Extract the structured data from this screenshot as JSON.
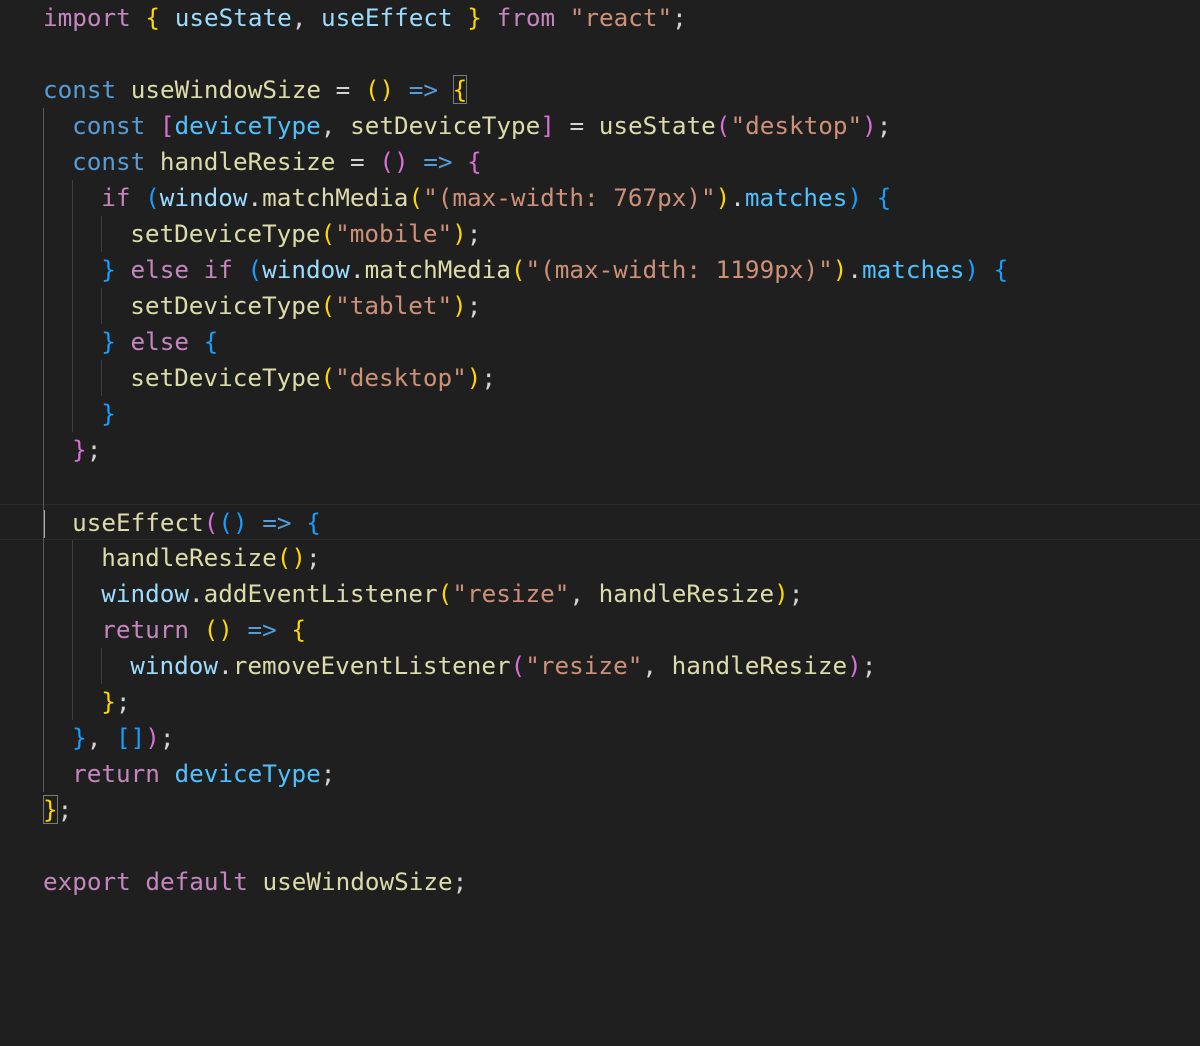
{
  "editor": {
    "language": "javascript",
    "theme": {
      "background": "#1f1f1f",
      "keyword_control": "#c586c0",
      "keyword_storage": "#569cd6",
      "function": "#dcdcaa",
      "variable": "#9cdcfe",
      "string": "#ce9178",
      "number": "#b5cea8",
      "punctuation": "#d4d4d4",
      "bracket_gold": "#ffd700",
      "bracket_orchid": "#da70d6",
      "bracket_blue": "#179fff"
    },
    "cursor_line": 14,
    "lines": [
      {
        "indent": 0,
        "tokens": [
          {
            "t": "import",
            "c": "#c586c0"
          },
          {
            "t": " "
          },
          {
            "t": "{",
            "c": "#ffd700"
          },
          {
            "t": " "
          },
          {
            "t": "useState",
            "c": "#9cdcfe"
          },
          {
            "t": ", "
          },
          {
            "t": "useEffect",
            "c": "#9cdcfe"
          },
          {
            "t": " "
          },
          {
            "t": "}",
            "c": "#ffd700"
          },
          {
            "t": " "
          },
          {
            "t": "from",
            "c": "#c586c0"
          },
          {
            "t": " "
          },
          {
            "t": "\"react\"",
            "c": "#ce9178"
          },
          {
            "t": ";"
          }
        ]
      },
      {
        "indent": 0,
        "tokens": []
      },
      {
        "indent": 0,
        "tokens": [
          {
            "t": "const",
            "c": "#569cd6"
          },
          {
            "t": " "
          },
          {
            "t": "useWindowSize",
            "c": "#dcdcaa"
          },
          {
            "t": " = "
          },
          {
            "t": "()",
            "c": "#ffd700"
          },
          {
            "t": " "
          },
          {
            "t": "=>",
            "c": "#569cd6"
          },
          {
            "t": " "
          },
          {
            "t": "{",
            "c": "#ffd700",
            "box": true
          }
        ]
      },
      {
        "indent": 1,
        "tokens": [
          {
            "t": "const",
            "c": "#569cd6"
          },
          {
            "t": " "
          },
          {
            "t": "[",
            "c": "#da70d6"
          },
          {
            "t": "deviceType",
            "c": "#4fc1ff"
          },
          {
            "t": ", "
          },
          {
            "t": "setDeviceType",
            "c": "#dcdcaa"
          },
          {
            "t": "]",
            "c": "#da70d6"
          },
          {
            "t": " = "
          },
          {
            "t": "useState",
            "c": "#dcdcaa"
          },
          {
            "t": "(",
            "c": "#da70d6"
          },
          {
            "t": "\"desktop\"",
            "c": "#ce9178"
          },
          {
            "t": ")",
            "c": "#da70d6"
          },
          {
            "t": ";"
          }
        ]
      },
      {
        "indent": 1,
        "tokens": [
          {
            "t": "const",
            "c": "#569cd6"
          },
          {
            "t": " "
          },
          {
            "t": "handleResize",
            "c": "#dcdcaa"
          },
          {
            "t": " = "
          },
          {
            "t": "()",
            "c": "#da70d6"
          },
          {
            "t": " "
          },
          {
            "t": "=>",
            "c": "#569cd6"
          },
          {
            "t": " "
          },
          {
            "t": "{",
            "c": "#da70d6"
          }
        ]
      },
      {
        "indent": 2,
        "tokens": [
          {
            "t": "if",
            "c": "#c586c0"
          },
          {
            "t": " "
          },
          {
            "t": "(",
            "c": "#179fff"
          },
          {
            "t": "window",
            "c": "#9cdcfe"
          },
          {
            "t": "."
          },
          {
            "t": "matchMedia",
            "c": "#dcdcaa"
          },
          {
            "t": "(",
            "c": "#ffd700"
          },
          {
            "t": "\"(max-width: 767px)\"",
            "c": "#ce9178"
          },
          {
            "t": ")",
            "c": "#ffd700"
          },
          {
            "t": "."
          },
          {
            "t": "matches",
            "c": "#4fc1ff"
          },
          {
            "t": ")",
            "c": "#179fff"
          },
          {
            "t": " "
          },
          {
            "t": "{",
            "c": "#179fff"
          }
        ]
      },
      {
        "indent": 3,
        "tokens": [
          {
            "t": "setDeviceType",
            "c": "#dcdcaa"
          },
          {
            "t": "(",
            "c": "#ffd700"
          },
          {
            "t": "\"mobile\"",
            "c": "#ce9178"
          },
          {
            "t": ")",
            "c": "#ffd700"
          },
          {
            "t": ";"
          }
        ]
      },
      {
        "indent": 2,
        "tokens": [
          {
            "t": "}",
            "c": "#179fff"
          },
          {
            "t": " "
          },
          {
            "t": "else",
            "c": "#c586c0"
          },
          {
            "t": " "
          },
          {
            "t": "if",
            "c": "#c586c0"
          },
          {
            "t": " "
          },
          {
            "t": "(",
            "c": "#179fff"
          },
          {
            "t": "window",
            "c": "#9cdcfe"
          },
          {
            "t": "."
          },
          {
            "t": "matchMedia",
            "c": "#dcdcaa"
          },
          {
            "t": "(",
            "c": "#ffd700"
          },
          {
            "t": "\"(max-width: 1199px)\"",
            "c": "#ce9178"
          },
          {
            "t": ")",
            "c": "#ffd700"
          },
          {
            "t": "."
          },
          {
            "t": "matches",
            "c": "#4fc1ff"
          },
          {
            "t": ")",
            "c": "#179fff"
          },
          {
            "t": " "
          },
          {
            "t": "{",
            "c": "#179fff"
          }
        ]
      },
      {
        "indent": 3,
        "tokens": [
          {
            "t": "setDeviceType",
            "c": "#dcdcaa"
          },
          {
            "t": "(",
            "c": "#ffd700"
          },
          {
            "t": "\"tablet\"",
            "c": "#ce9178"
          },
          {
            "t": ")",
            "c": "#ffd700"
          },
          {
            "t": ";"
          }
        ]
      },
      {
        "indent": 2,
        "tokens": [
          {
            "t": "}",
            "c": "#179fff"
          },
          {
            "t": " "
          },
          {
            "t": "else",
            "c": "#c586c0"
          },
          {
            "t": " "
          },
          {
            "t": "{",
            "c": "#179fff"
          }
        ]
      },
      {
        "indent": 3,
        "tokens": [
          {
            "t": "setDeviceType",
            "c": "#dcdcaa"
          },
          {
            "t": "(",
            "c": "#ffd700"
          },
          {
            "t": "\"desktop\"",
            "c": "#ce9178"
          },
          {
            "t": ")",
            "c": "#ffd700"
          },
          {
            "t": ";"
          }
        ]
      },
      {
        "indent": 2,
        "tokens": [
          {
            "t": "}",
            "c": "#179fff"
          }
        ]
      },
      {
        "indent": 1,
        "tokens": [
          {
            "t": "}",
            "c": "#da70d6"
          },
          {
            "t": ";"
          }
        ]
      },
      {
        "indent": 0,
        "tokens": []
      },
      {
        "indent": 1,
        "tokens": [
          {
            "t": "useEffect",
            "c": "#dcdcaa"
          },
          {
            "t": "(",
            "c": "#da70d6"
          },
          {
            "t": "()",
            "c": "#179fff"
          },
          {
            "t": " "
          },
          {
            "t": "=>",
            "c": "#569cd6"
          },
          {
            "t": " "
          },
          {
            "t": "{",
            "c": "#179fff"
          }
        ]
      },
      {
        "indent": 2,
        "tokens": [
          {
            "t": "handleResize",
            "c": "#dcdcaa"
          },
          {
            "t": "()",
            "c": "#ffd700"
          },
          {
            "t": ";"
          }
        ]
      },
      {
        "indent": 2,
        "tokens": [
          {
            "t": "window",
            "c": "#9cdcfe"
          },
          {
            "t": "."
          },
          {
            "t": "addEventListener",
            "c": "#dcdcaa"
          },
          {
            "t": "(",
            "c": "#ffd700"
          },
          {
            "t": "\"resize\"",
            "c": "#ce9178"
          },
          {
            "t": ", "
          },
          {
            "t": "handleResize",
            "c": "#dcdcaa"
          },
          {
            "t": ")",
            "c": "#ffd700"
          },
          {
            "t": ";"
          }
        ]
      },
      {
        "indent": 2,
        "tokens": [
          {
            "t": "return",
            "c": "#c586c0"
          },
          {
            "t": " "
          },
          {
            "t": "()",
            "c": "#ffd700"
          },
          {
            "t": " "
          },
          {
            "t": "=>",
            "c": "#569cd6"
          },
          {
            "t": " "
          },
          {
            "t": "{",
            "c": "#ffd700"
          }
        ]
      },
      {
        "indent": 3,
        "tokens": [
          {
            "t": "window",
            "c": "#9cdcfe"
          },
          {
            "t": "."
          },
          {
            "t": "removeEventListener",
            "c": "#dcdcaa"
          },
          {
            "t": "(",
            "c": "#da70d6"
          },
          {
            "t": "\"resize\"",
            "c": "#ce9178"
          },
          {
            "t": ", "
          },
          {
            "t": "handleResize",
            "c": "#dcdcaa"
          },
          {
            "t": ")",
            "c": "#da70d6"
          },
          {
            "t": ";"
          }
        ]
      },
      {
        "indent": 2,
        "tokens": [
          {
            "t": "}",
            "c": "#ffd700"
          },
          {
            "t": ";"
          }
        ]
      },
      {
        "indent": 1,
        "tokens": [
          {
            "t": "}",
            "c": "#179fff"
          },
          {
            "t": ", "
          },
          {
            "t": "[]",
            "c": "#179fff"
          },
          {
            "t": ")",
            "c": "#da70d6"
          },
          {
            "t": ";"
          }
        ]
      },
      {
        "indent": 1,
        "tokens": [
          {
            "t": "return",
            "c": "#c586c0"
          },
          {
            "t": " "
          },
          {
            "t": "deviceType",
            "c": "#4fc1ff"
          },
          {
            "t": ";"
          }
        ]
      },
      {
        "indent": 0,
        "tokens": [
          {
            "t": "}",
            "c": "#ffd700",
            "box": true
          },
          {
            "t": ";"
          }
        ]
      },
      {
        "indent": 0,
        "tokens": []
      },
      {
        "indent": 0,
        "tokens": [
          {
            "t": "export",
            "c": "#c586c0"
          },
          {
            "t": " "
          },
          {
            "t": "default",
            "c": "#c586c0"
          },
          {
            "t": " "
          },
          {
            "t": "useWindowSize",
            "c": "#dcdcaa"
          },
          {
            "t": ";"
          }
        ]
      }
    ]
  }
}
